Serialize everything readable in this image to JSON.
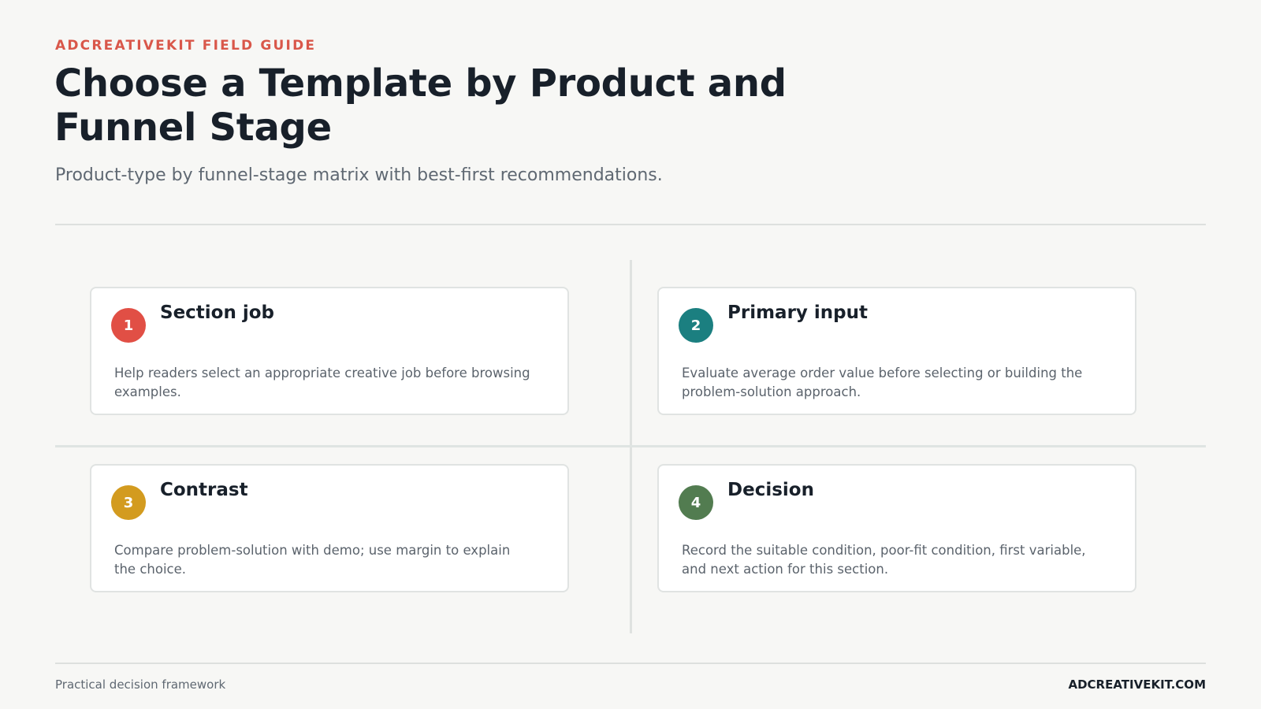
{
  "header": {
    "eyebrow": "ADCREATIVEKIT FIELD GUIDE",
    "title": "Choose a Template by Product and Funnel Stage",
    "subtitle": "Product-type by funnel-stage matrix with best-first recommendations."
  },
  "cards": [
    {
      "number": "1",
      "title": "Section job",
      "body": "Help readers select an appropriate creative job before browsing examples.",
      "color": "#e14f45"
    },
    {
      "number": "2",
      "title": "Primary input",
      "body": "Evaluate average order value before selecting or building the problem-solution approach.",
      "color": "#1b7f80"
    },
    {
      "number": "3",
      "title": "Contrast",
      "body": "Compare problem-solution with demo; use margin to explain the choice.",
      "color": "#d39b1f"
    },
    {
      "number": "4",
      "title": "Decision",
      "body": "Record the suitable condition, poor-fit condition, first variable, and next action for this section.",
      "color": "#527c50"
    }
  ],
  "footer": {
    "left": "Practical decision framework",
    "right": "ADCREATIVEKIT.COM"
  }
}
